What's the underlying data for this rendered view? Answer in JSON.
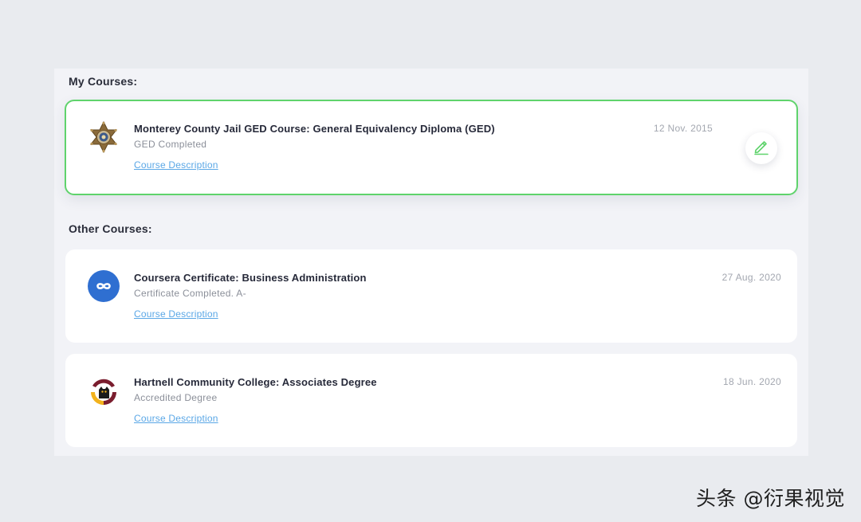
{
  "my_courses": {
    "heading": "My Courses:",
    "items": [
      {
        "title": "Monterey County Jail GED Course: General Equivalency Diploma (GED)",
        "subtitle": "GED Completed",
        "link": "Course Description",
        "date": "12 Nov. 2015",
        "logo_icon": "sheriff-star-badge-icon"
      }
    ],
    "edit_icon": "pencil-icon",
    "accent_color": "#5fd36c"
  },
  "other_courses": {
    "heading": "Other Courses:",
    "items": [
      {
        "title": "Coursera Certificate: Business Administration",
        "subtitle": "Certificate Completed. A-",
        "link": "Course Description",
        "date": "27 Aug. 2020",
        "logo_icon": "coursera-logo-icon"
      },
      {
        "title": "Hartnell Community College: Associates Degree",
        "subtitle": "Accredited Degree",
        "link": "Course Description",
        "date": "18 Jun. 2020",
        "logo_icon": "hartnell-panther-logo-icon"
      }
    ]
  },
  "colors": {
    "link": "#5aa7e6",
    "title": "#262939",
    "muted": "#8b8f99"
  },
  "watermark": "头条 @衍果视觉"
}
